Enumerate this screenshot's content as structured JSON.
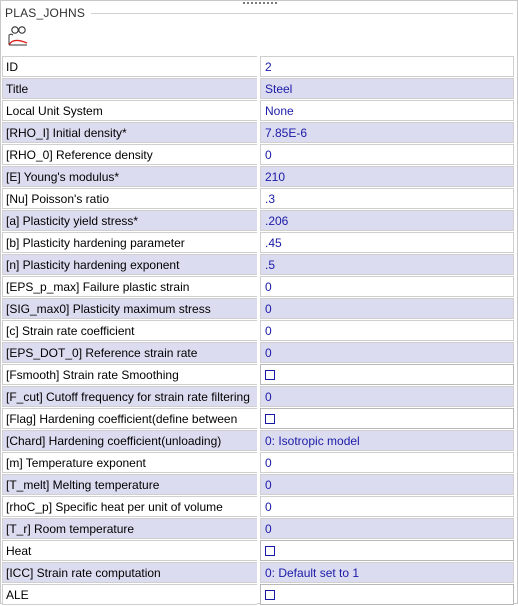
{
  "panel": {
    "title": "PLAS_JOHNS",
    "icon": "material-curve-icon"
  },
  "rows": [
    {
      "label": "ID",
      "value": "2",
      "alt": false,
      "type": "text"
    },
    {
      "label": "Title",
      "value": "Steel",
      "alt": true,
      "type": "text"
    },
    {
      "label": "Local Unit System",
      "value": "None",
      "alt": false,
      "type": "text"
    },
    {
      "label": "[RHO_I] Initial density*",
      "value": "7.85E-6",
      "alt": true,
      "type": "text"
    },
    {
      "label": "[RHO_0] Reference density",
      "value": "0",
      "alt": false,
      "type": "text"
    },
    {
      "label": "[E] Young's modulus*",
      "value": "210",
      "alt": true,
      "type": "text"
    },
    {
      "label": "[Nu] Poisson's ratio",
      "value": ".3",
      "alt": false,
      "type": "text"
    },
    {
      "label": "[a] Plasticity yield stress*",
      "value": ".206",
      "alt": true,
      "type": "text"
    },
    {
      "label": "[b] Plasticity hardening parameter",
      "value": ".45",
      "alt": false,
      "type": "text"
    },
    {
      "label": "[n] Plasticity hardening exponent",
      "value": ".5",
      "alt": true,
      "type": "text"
    },
    {
      "label": "[EPS_p_max] Failure plastic strain",
      "value": "0",
      "alt": false,
      "type": "text"
    },
    {
      "label": "[SIG_max0] Plasticity maximum stress",
      "value": "0",
      "alt": true,
      "type": "text"
    },
    {
      "label": "[c] Strain rate coefficient",
      "value": "0",
      "alt": false,
      "type": "text"
    },
    {
      "label": "[EPS_DOT_0] Reference strain rate",
      "value": "0",
      "alt": true,
      "type": "text"
    },
    {
      "label": "[Fsmooth] Strain rate Smoothing",
      "value": "",
      "alt": false,
      "type": "checkbox"
    },
    {
      "label": "[F_cut] Cutoff frequency for strain rate filtering",
      "value": "0",
      "alt": true,
      "type": "text"
    },
    {
      "label": "[Flag] Hardening coefficient(define between",
      "value": "",
      "alt": false,
      "type": "checkbox"
    },
    {
      "label": "[Chard] Hardening coefficient(unloading)",
      "value": "0: Isotropic model",
      "alt": true,
      "type": "text"
    },
    {
      "label": "[m] Temperature exponent",
      "value": "0",
      "alt": false,
      "type": "text"
    },
    {
      "label": "[T_melt] Melting temperature",
      "value": "0",
      "alt": true,
      "type": "text"
    },
    {
      "label": "[rhoC_p] Specific heat per unit of volume",
      "value": "0",
      "alt": false,
      "type": "text"
    },
    {
      "label": "[T_r] Room temperature",
      "value": "0",
      "alt": true,
      "type": "text"
    },
    {
      "label": "Heat",
      "value": "",
      "alt": false,
      "type": "checkbox"
    },
    {
      "label": "[ICC] Strain rate computation",
      "value": "0: Default set to 1",
      "alt": true,
      "type": "text"
    },
    {
      "label": "ALE",
      "value": "",
      "alt": false,
      "type": "checkbox"
    }
  ]
}
